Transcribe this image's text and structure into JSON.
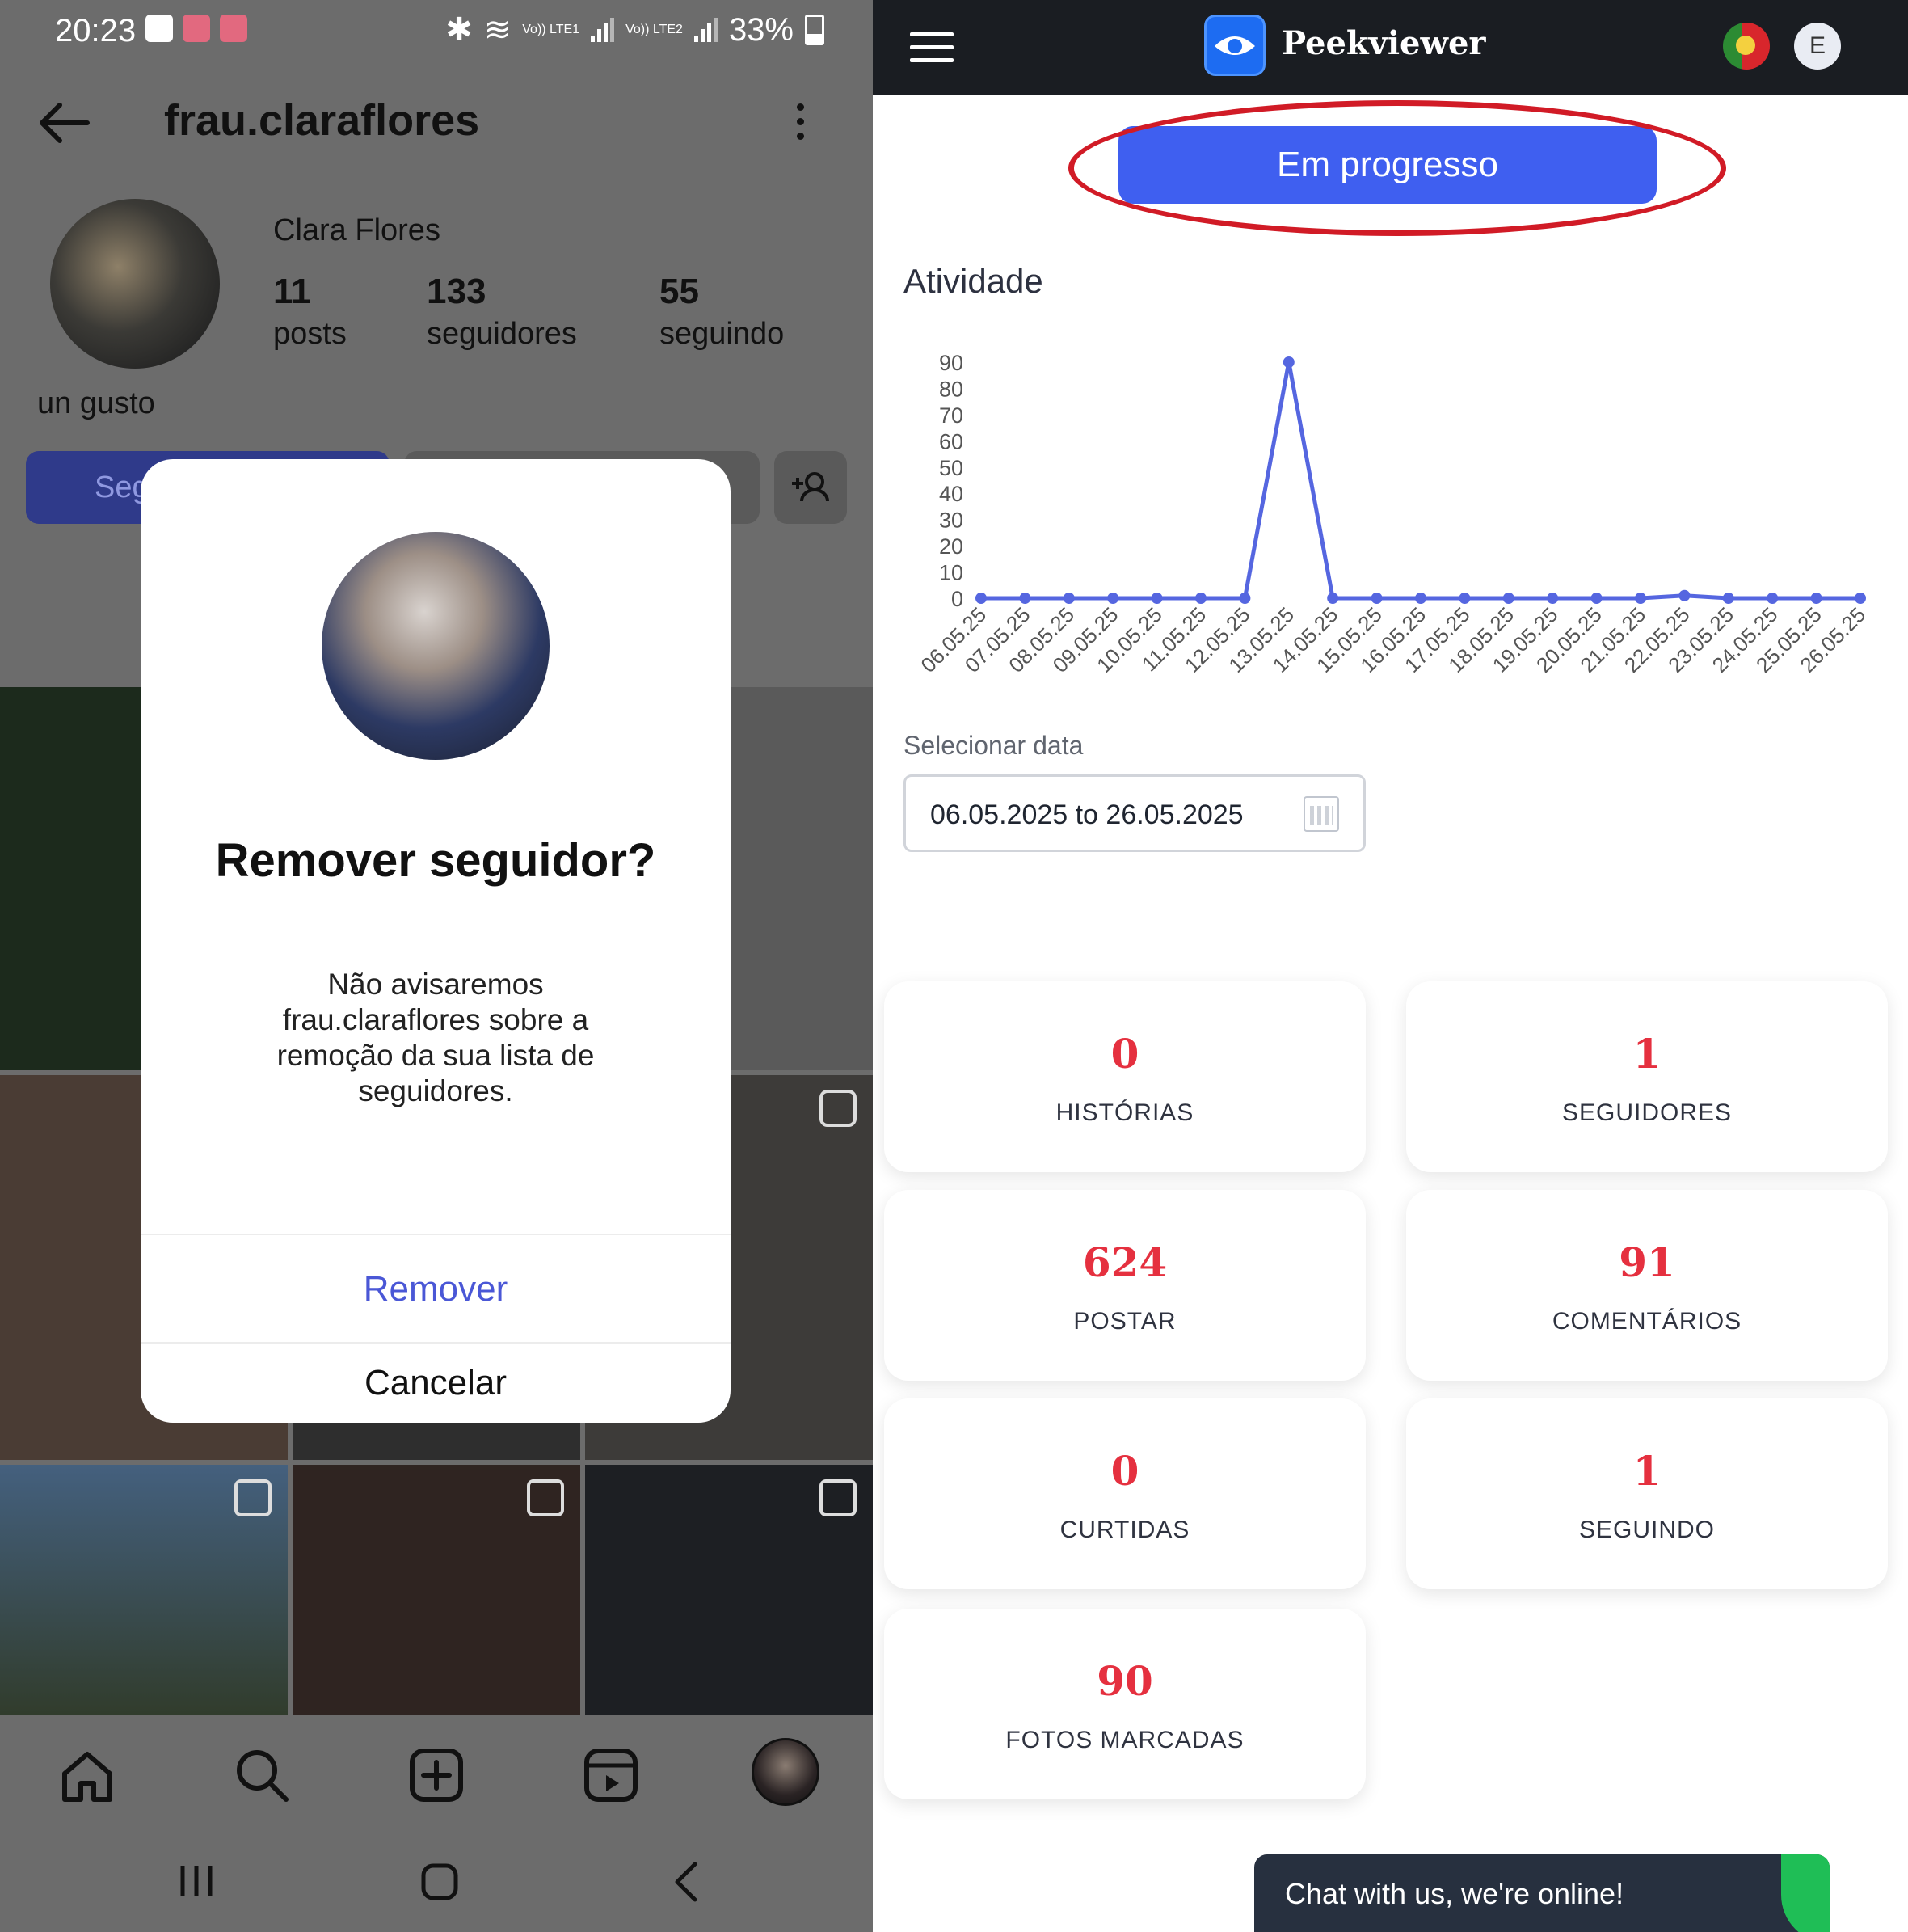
{
  "instagram": {
    "status_bar": {
      "time": "20:23",
      "sim1": "Vo)) LTE1",
      "sim2": "Vo)) LTE2",
      "battery": "33%"
    },
    "username": "frau.claraflores",
    "profile_name": "Clara Flores",
    "stats": [
      {
        "value": "11",
        "label": "posts"
      },
      {
        "value": "133",
        "label": "seguidores"
      },
      {
        "value": "55",
        "label": "seguindo"
      }
    ],
    "bio": "un gusto",
    "follow_button_label": "Seg",
    "modal": {
      "title": "Remover seguidor?",
      "body": "Não avisaremos frau.claraflores sobre a remoção da sua lista de seguidores.",
      "remove_label": "Remover",
      "cancel_label": "Cancelar"
    },
    "nav_icons": [
      "home-icon",
      "search-icon",
      "create-icon",
      "reels-icon",
      "profile-avatar"
    ]
  },
  "peekviewer": {
    "brand": "Peekviewer",
    "user_initial": "E",
    "progress_button": "Em progresso",
    "activity_title": "Atividade",
    "date_label": "Selecionar data",
    "date_range": "06.05.2025 to 26.05.2025",
    "stats": [
      {
        "value": "0",
        "label": "HISTÓRIAS"
      },
      {
        "value": "1",
        "label": "SEGUIDORES"
      },
      {
        "value": "624",
        "label": "POSTAR"
      },
      {
        "value": "91",
        "label": "COMENTÁRIOS"
      },
      {
        "value": "0",
        "label": "CURTIDAS"
      },
      {
        "value": "1",
        "label": "SEGUINDO"
      },
      {
        "value": "90",
        "label": "FOTOS MARCADAS"
      }
    ],
    "chat_text": "Chat with us, we're online!",
    "colors": {
      "accent": "#3f5ff0",
      "line": "#5566e0",
      "highlight": "#d11b26",
      "stat_value": "#e5303f"
    }
  },
  "chart_data": {
    "type": "line",
    "title": "Atividade",
    "x": [
      "06.05.25",
      "07.05.25",
      "08.05.25",
      "09.05.25",
      "10.05.25",
      "11.05.25",
      "12.05.25",
      "13.05.25",
      "14.05.25",
      "15.05.25",
      "16.05.25",
      "17.05.25",
      "18.05.25",
      "19.05.25",
      "20.05.25",
      "21.05.25",
      "22.05.25",
      "23.05.25",
      "24.05.25",
      "25.05.25",
      "26.05.25"
    ],
    "y": [
      0,
      0,
      0,
      0,
      0,
      0,
      0,
      90,
      0,
      0,
      0,
      0,
      0,
      0,
      0,
      0,
      1,
      0,
      0,
      0,
      0
    ],
    "yticks": [
      0,
      10,
      20,
      30,
      40,
      50,
      60,
      70,
      80,
      90
    ],
    "ylim": [
      0,
      90
    ],
    "grid": false,
    "legend": "none"
  }
}
